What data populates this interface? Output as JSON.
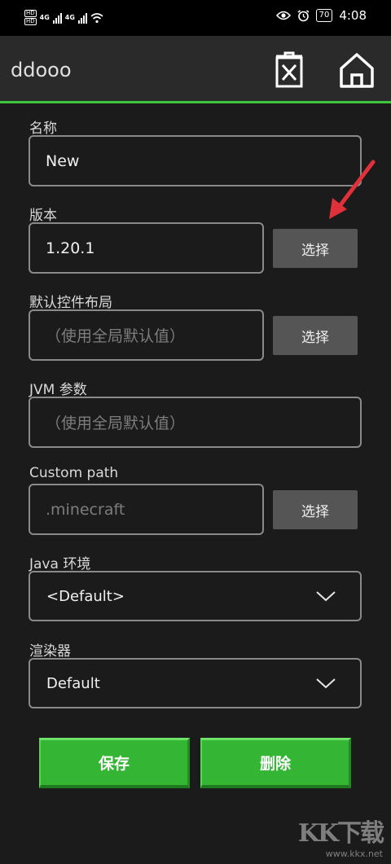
{
  "status_bar": {
    "network_left": [
      "HD",
      "HD"
    ],
    "network_type": [
      "4G",
      "4G"
    ],
    "battery": "70",
    "time": "4:08"
  },
  "app_bar": {
    "title": "ddooo"
  },
  "form": {
    "name": {
      "label": "名称",
      "value": "New"
    },
    "version": {
      "label": "版本",
      "value": "1.20.1",
      "button": "选择"
    },
    "control_layout": {
      "label": "默认控件布局",
      "placeholder": "（使用全局默认值）",
      "button": "选择"
    },
    "jvm_args": {
      "label": "JVM 参数",
      "placeholder": "（使用全局默认值）"
    },
    "custom_path": {
      "label": "Custom path",
      "placeholder": ".minecraft",
      "button": "选择"
    },
    "java_env": {
      "label": "Java 环境",
      "value": "<Default>"
    },
    "renderer": {
      "label": "渲染器",
      "value": "Default"
    }
  },
  "actions": {
    "save": "保存",
    "delete": "删除"
  },
  "watermark": {
    "logo": "KK下载",
    "url": "www.kkx.net"
  },
  "colors": {
    "accent": "#3fc33a",
    "annotation_arrow": "#e0303a"
  }
}
